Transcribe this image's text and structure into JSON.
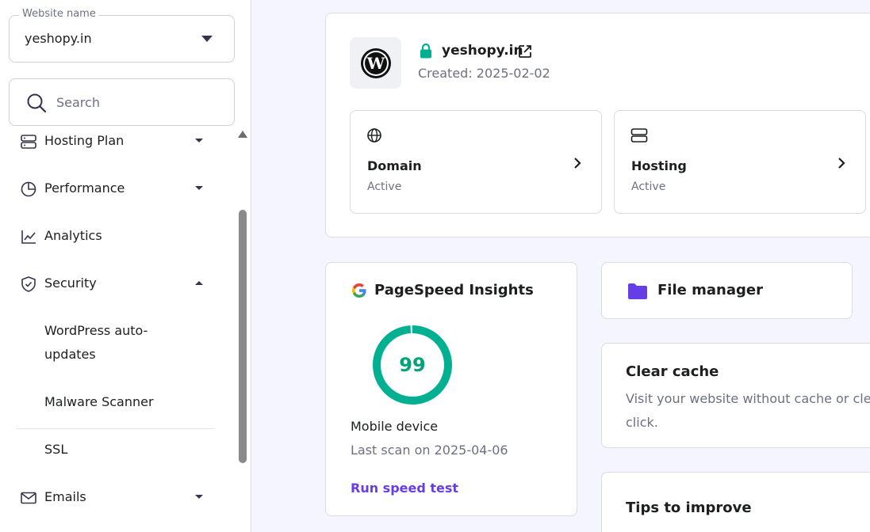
{
  "sidebar": {
    "website_select": {
      "legend": "Website name",
      "value": "yeshopy.in"
    },
    "search": {
      "placeholder": "Search"
    },
    "items": [
      {
        "label": "Hosting Plan",
        "icon": "server-icon",
        "expandable": true
      },
      {
        "label": "Performance",
        "icon": "pie-chart-icon",
        "expandable": true
      },
      {
        "label": "Analytics",
        "icon": "line-chart-icon",
        "expandable": false
      },
      {
        "label": "Security",
        "icon": "shield-icon",
        "expandable": true,
        "expanded": true
      },
      {
        "label": "Emails",
        "icon": "mail-icon",
        "expandable": true
      }
    ],
    "security_subitems": [
      "WordPress auto-",
      "updates",
      "Malware Scanner",
      "SSL"
    ]
  },
  "site": {
    "name": "yeshopy.in",
    "created": "Created: 2025-02-02",
    "domain": {
      "title": "Domain",
      "status": "Active"
    },
    "hosting": {
      "title": "Hosting",
      "status": "Active"
    }
  },
  "pagespeed": {
    "title": "PageSpeed Insights",
    "score": "99",
    "score_fraction": 0.99,
    "device": "Mobile device",
    "last_scan": "Last scan on 2025-04-06",
    "action": "Run speed test"
  },
  "file_manager": {
    "title": "File manager"
  },
  "clear_cache": {
    "title": "Clear cache",
    "desc_line1": "Visit your website without cache or cle",
    "desc_line2": "click."
  },
  "tips": {
    "title": "Tips to improve"
  },
  "colors": {
    "accent": "#673de6",
    "success": "#00b090",
    "folder": "#673de6"
  }
}
